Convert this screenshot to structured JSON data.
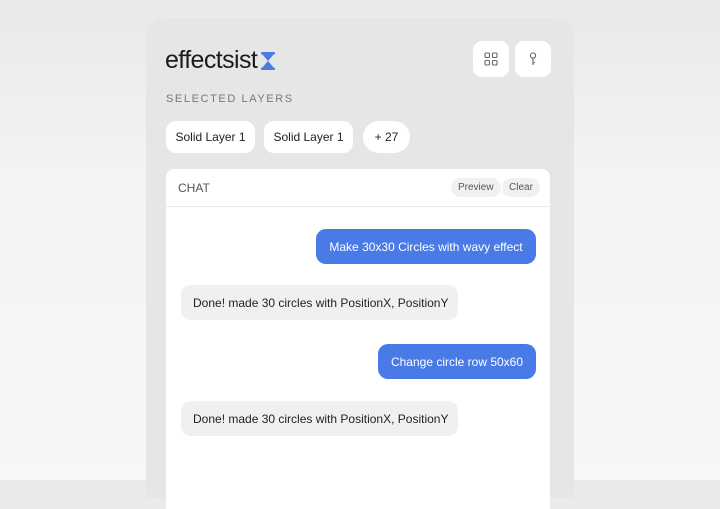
{
  "app": {
    "name": "effectsist",
    "accent_color": "#4a7ae6"
  },
  "toolbar": {
    "buttons": [
      {
        "icon": "grid-icon"
      },
      {
        "icon": "key-icon"
      }
    ]
  },
  "selected_layers": {
    "label": "SELECTED LAYERS",
    "chips": [
      "Solid Layer 1",
      "Solid Layer 1",
      "+ 27"
    ]
  },
  "chat": {
    "title": "CHAT",
    "actions": {
      "preview": "Preview",
      "clear": "Clear"
    },
    "messages": [
      {
        "role": "user",
        "text": "Make 30x30 Circles with wavy effect"
      },
      {
        "role": "assistant",
        "text": "Done! made 30 circles with PositionX, PositionY"
      },
      {
        "role": "user",
        "text": "Change circle row 50x60"
      },
      {
        "role": "assistant",
        "text": "Done! made 30 circles with PositionX, PositionY"
      }
    ]
  }
}
